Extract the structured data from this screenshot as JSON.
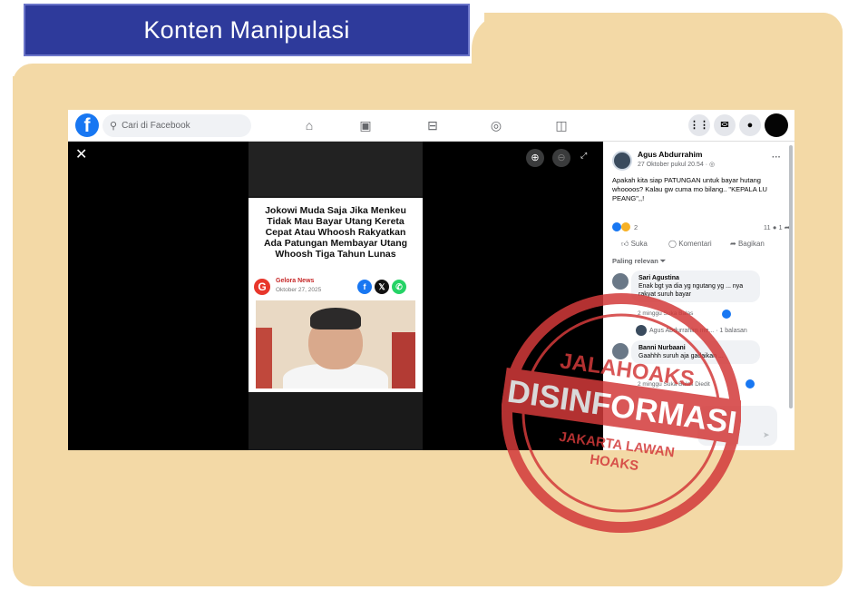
{
  "banner": {
    "title": "Konten Manipulasi"
  },
  "facebook": {
    "search_placeholder": "Cari di Facebook",
    "logo_letter": "f",
    "nav_icons": [
      "home-icon",
      "video-icon",
      "marketplace-icon",
      "groups-icon",
      "gaming-icon"
    ],
    "right_icons": [
      "menu-grid-icon",
      "messenger-icon",
      "notifications-icon",
      "profile-avatar"
    ]
  },
  "viewer": {
    "close_glyph": "✕",
    "zoom_in_glyph": "⊕",
    "zoom_out_glyph": "⊖",
    "expand_glyph": "⤢"
  },
  "article": {
    "headline": "Jokowi Muda Saja Jika Menkeu Tidak Mau Bayar Utang Kereta Cepat Atau Whoosh Rakyatkan Ada Patungan Membayar Utang Whoosh Tiga Tahun Lunas",
    "source_name": "Gelora News",
    "source_date": "Oktober 27, 2025",
    "source_logo_letter": "G",
    "share_icons": [
      "facebook-share-icon",
      "x-share-icon",
      "whatsapp-share-icon"
    ],
    "share_glyphs": [
      "f",
      "𝕏",
      "✆"
    ]
  },
  "post": {
    "author": "Agus Abdurrahim",
    "time": "27 Oktober pukul 20.54 · ◎",
    "text": "Apakah kita siap PATUNGAN untuk bayar hutang whoooos? Kalau gw cuma mo bilang.. \"KEPALA LU PEANG\",,!",
    "reaction_count": "2",
    "comment_count": "11",
    "share_count": "1",
    "actions": {
      "like": "Suka",
      "comment": "Komentari",
      "share": "Bagikan"
    },
    "sort_label": "Paling relevan ⏷",
    "more": "···"
  },
  "comments": [
    {
      "name": "Sari Agustina",
      "text": "Enak bgt ya dia yg ngutang yg ... nya rakyat suruh bayar",
      "meta": "2 minggu   Suka   Balas"
    },
    {
      "name": "Banni Nurbaani",
      "text": "Gaahhh suruh aja gadaikan ...",
      "meta": "2 minggu   Suka   Balas   Diedit"
    }
  ],
  "reply_preview": {
    "text": "Agus Abdurrahim me...  · 1 balasan"
  },
  "stamp": {
    "top": "JALAHOAKS",
    "main": "DISINFORMASI",
    "bottom_1": "JAKARTA LAWAN",
    "bottom_2": "HOAKS"
  },
  "colors": {
    "banner": "#2e3a9b",
    "card": "#f3d9a6",
    "facebook_blue": "#1877f2",
    "stamp_red": "#d33a3a"
  }
}
